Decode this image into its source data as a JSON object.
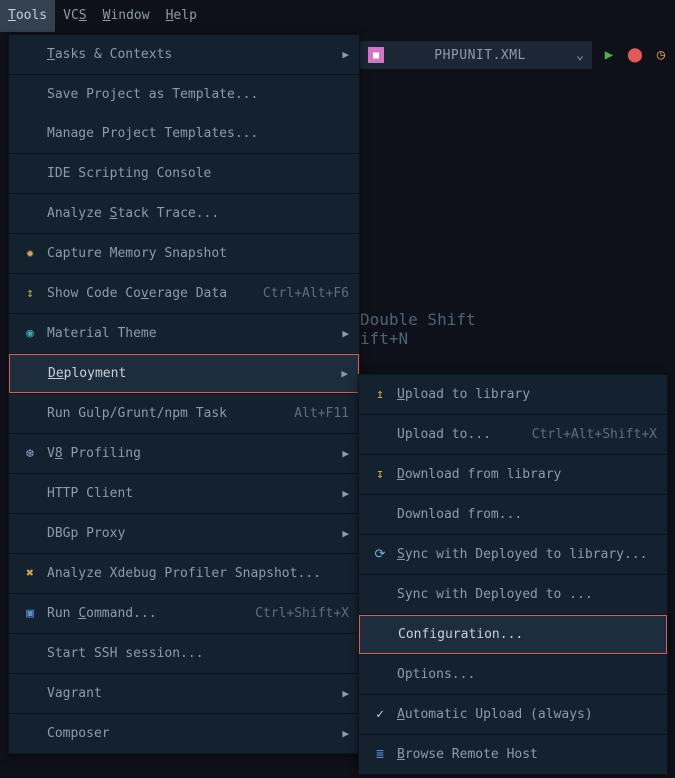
{
  "menubar": {
    "tools": "Tools",
    "vcs": "VCS",
    "window": "Window",
    "help": "Help"
  },
  "toolbar": {
    "config_label": "PHPUNIT.XML"
  },
  "bg_hints": {
    "line1": "Double Shift",
    "line2": "ift+N"
  },
  "menu": {
    "tasks": "Tasks & Contexts",
    "save_template": "Save Project as Template...",
    "manage_templates": "Manage Project Templates...",
    "ide_console": "IDE Scripting Console",
    "analyze_stack": "Analyze Stack Trace...",
    "capture_mem": "Capture Memory Snapshot",
    "show_coverage": "Show Code Coverage Data",
    "show_coverage_sc": "Ctrl+Alt+F6",
    "material_theme": "Material Theme",
    "deployment": "Deployment",
    "run_gulp": "Run Gulp/Grunt/npm Task",
    "run_gulp_sc": "Alt+F11",
    "v8": "V8 Profiling",
    "http_client": "HTTP Client",
    "dbgp": "DBGp Proxy",
    "xdebug": "Analyze Xdebug Profiler Snapshot...",
    "run_cmd": "Run Command...",
    "run_cmd_sc": "Ctrl+Shift+X",
    "ssh": "Start SSH session...",
    "vagrant": "Vagrant",
    "composer": "Composer"
  },
  "submenu": {
    "upload": "Upload to library",
    "upload_to": "Upload to...",
    "upload_to_sc": "Ctrl+Alt+Shift+X",
    "download": "Download from library",
    "download_from": "Download from...",
    "sync": "Sync with Deployed to library...",
    "sync_with": "Sync with Deployed to ...",
    "configuration": "Configuration...",
    "options": "Options...",
    "auto_upload": "Automatic Upload (always)",
    "browse": "Browse Remote Host"
  }
}
